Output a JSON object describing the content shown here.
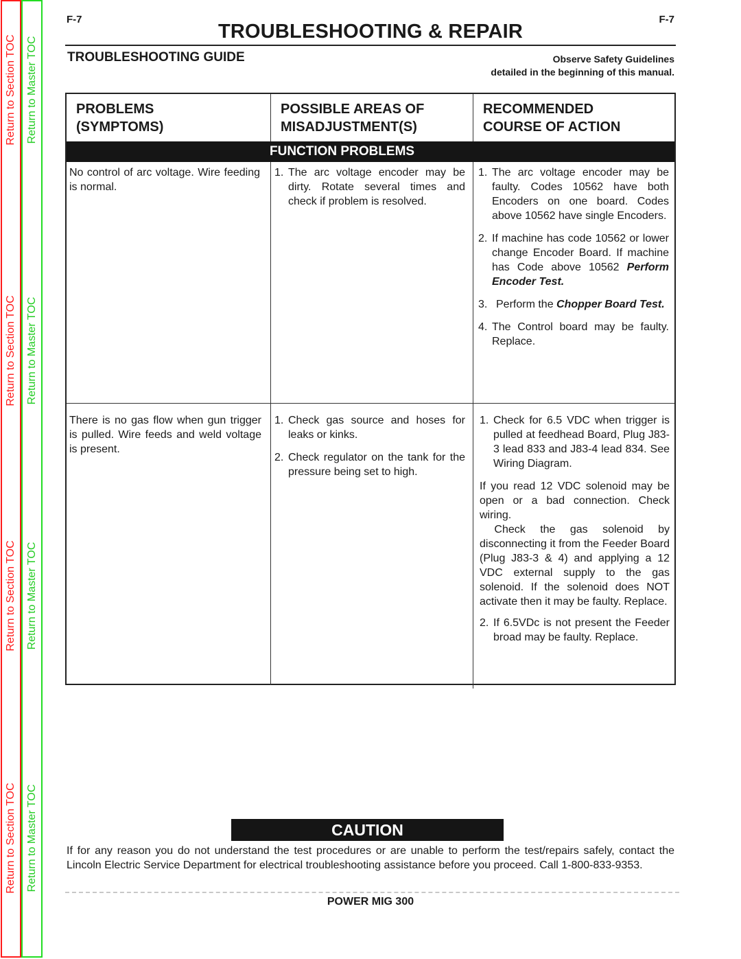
{
  "side_nav": {
    "section_toc": "Return to Section TOC",
    "master_toc": "Return to Master TOC",
    "colors": {
      "section": "#ff1a1a",
      "master": "#22cc22"
    }
  },
  "header": {
    "page_left": "F-7",
    "page_right": "F-7",
    "title": "TROUBLESHOOTING & REPAIR",
    "subtitle": "TROUBLESHOOTING GUIDE",
    "safety_line1": "Observe Safety Guidelines",
    "safety_line2": "detailed in the beginning of this manual."
  },
  "table": {
    "columns": [
      {
        "line1": "PROBLEMS",
        "line2": "(SYMPTOMS)"
      },
      {
        "line1": "POSSIBLE AREAS OF",
        "line2": "MISADJUSTMENT(S)"
      },
      {
        "line1": "RECOMMENDED",
        "line2": "COURSE OF ACTION"
      }
    ],
    "band": "FUNCTION PROBLEMS",
    "rows": [
      {
        "problem": "No control of arc voltage. Wire feeding is normal.",
        "areas": [
          {
            "num": "1.",
            "text": "The arc voltage encoder may be dirty. Rotate several times and check if problem is resolved."
          }
        ],
        "actions": [
          {
            "num": "1.",
            "text": "The arc voltage encoder may be faulty. Codes 10562 have both Encoders on one board. Codes above 10562 have single Encoders."
          },
          {
            "num": "2.",
            "text": "If machine has code 10562 or lower change Encoder Board. If machine has Code above 10562",
            "emph": "Perform Encoder Test."
          },
          {
            "num": "3.",
            "text": "Perform the",
            "emph": "Chopper Board Test."
          },
          {
            "num": "4.",
            "text": "The Control board may be faulty. Replace."
          }
        ]
      },
      {
        "problem": "There is no gas flow when gun trigger is pulled. Wire feeds and weld voltage is present.",
        "areas": [
          {
            "num": "1.",
            "text": "Check gas source and hoses for leaks or kinks."
          },
          {
            "num": "2.",
            "text": "Check regulator on the tank for the pressure being set to high."
          }
        ],
        "actions": [
          {
            "num": "1.",
            "text": "Check for 6.5 VDC when trigger is pulled at feedhead Board, Plug J83-3 lead 833 and J83-4 lead 834.  See Wiring Diagram."
          },
          {
            "num": "",
            "text": "If you read 12 VDC solenoid may be open or a bad connection. Check wiring."
          },
          {
            "num": "",
            "text": " Check the gas solenoid by disconnecting it from the Feeder Board (Plug J83-3 & 4) and applying a 12 VDC external supply to the gas solenoid. If the solenoid does NOT activate then it may be faulty. Replace."
          },
          {
            "num": "2.",
            "text": "If 6.5VDc is not present the Feeder broad may be faulty. Replace."
          }
        ]
      }
    ]
  },
  "caution": {
    "label": "CAUTION",
    "text": "If for any reason you do not understand the test procedures or are unable to perform the test/repairs safely, contact the Lincoln Electric Service Department for electrical troubleshooting assistance before you proceed.  Call 1-800-833-9353."
  },
  "footer": {
    "product": "POWER MIG 300"
  }
}
